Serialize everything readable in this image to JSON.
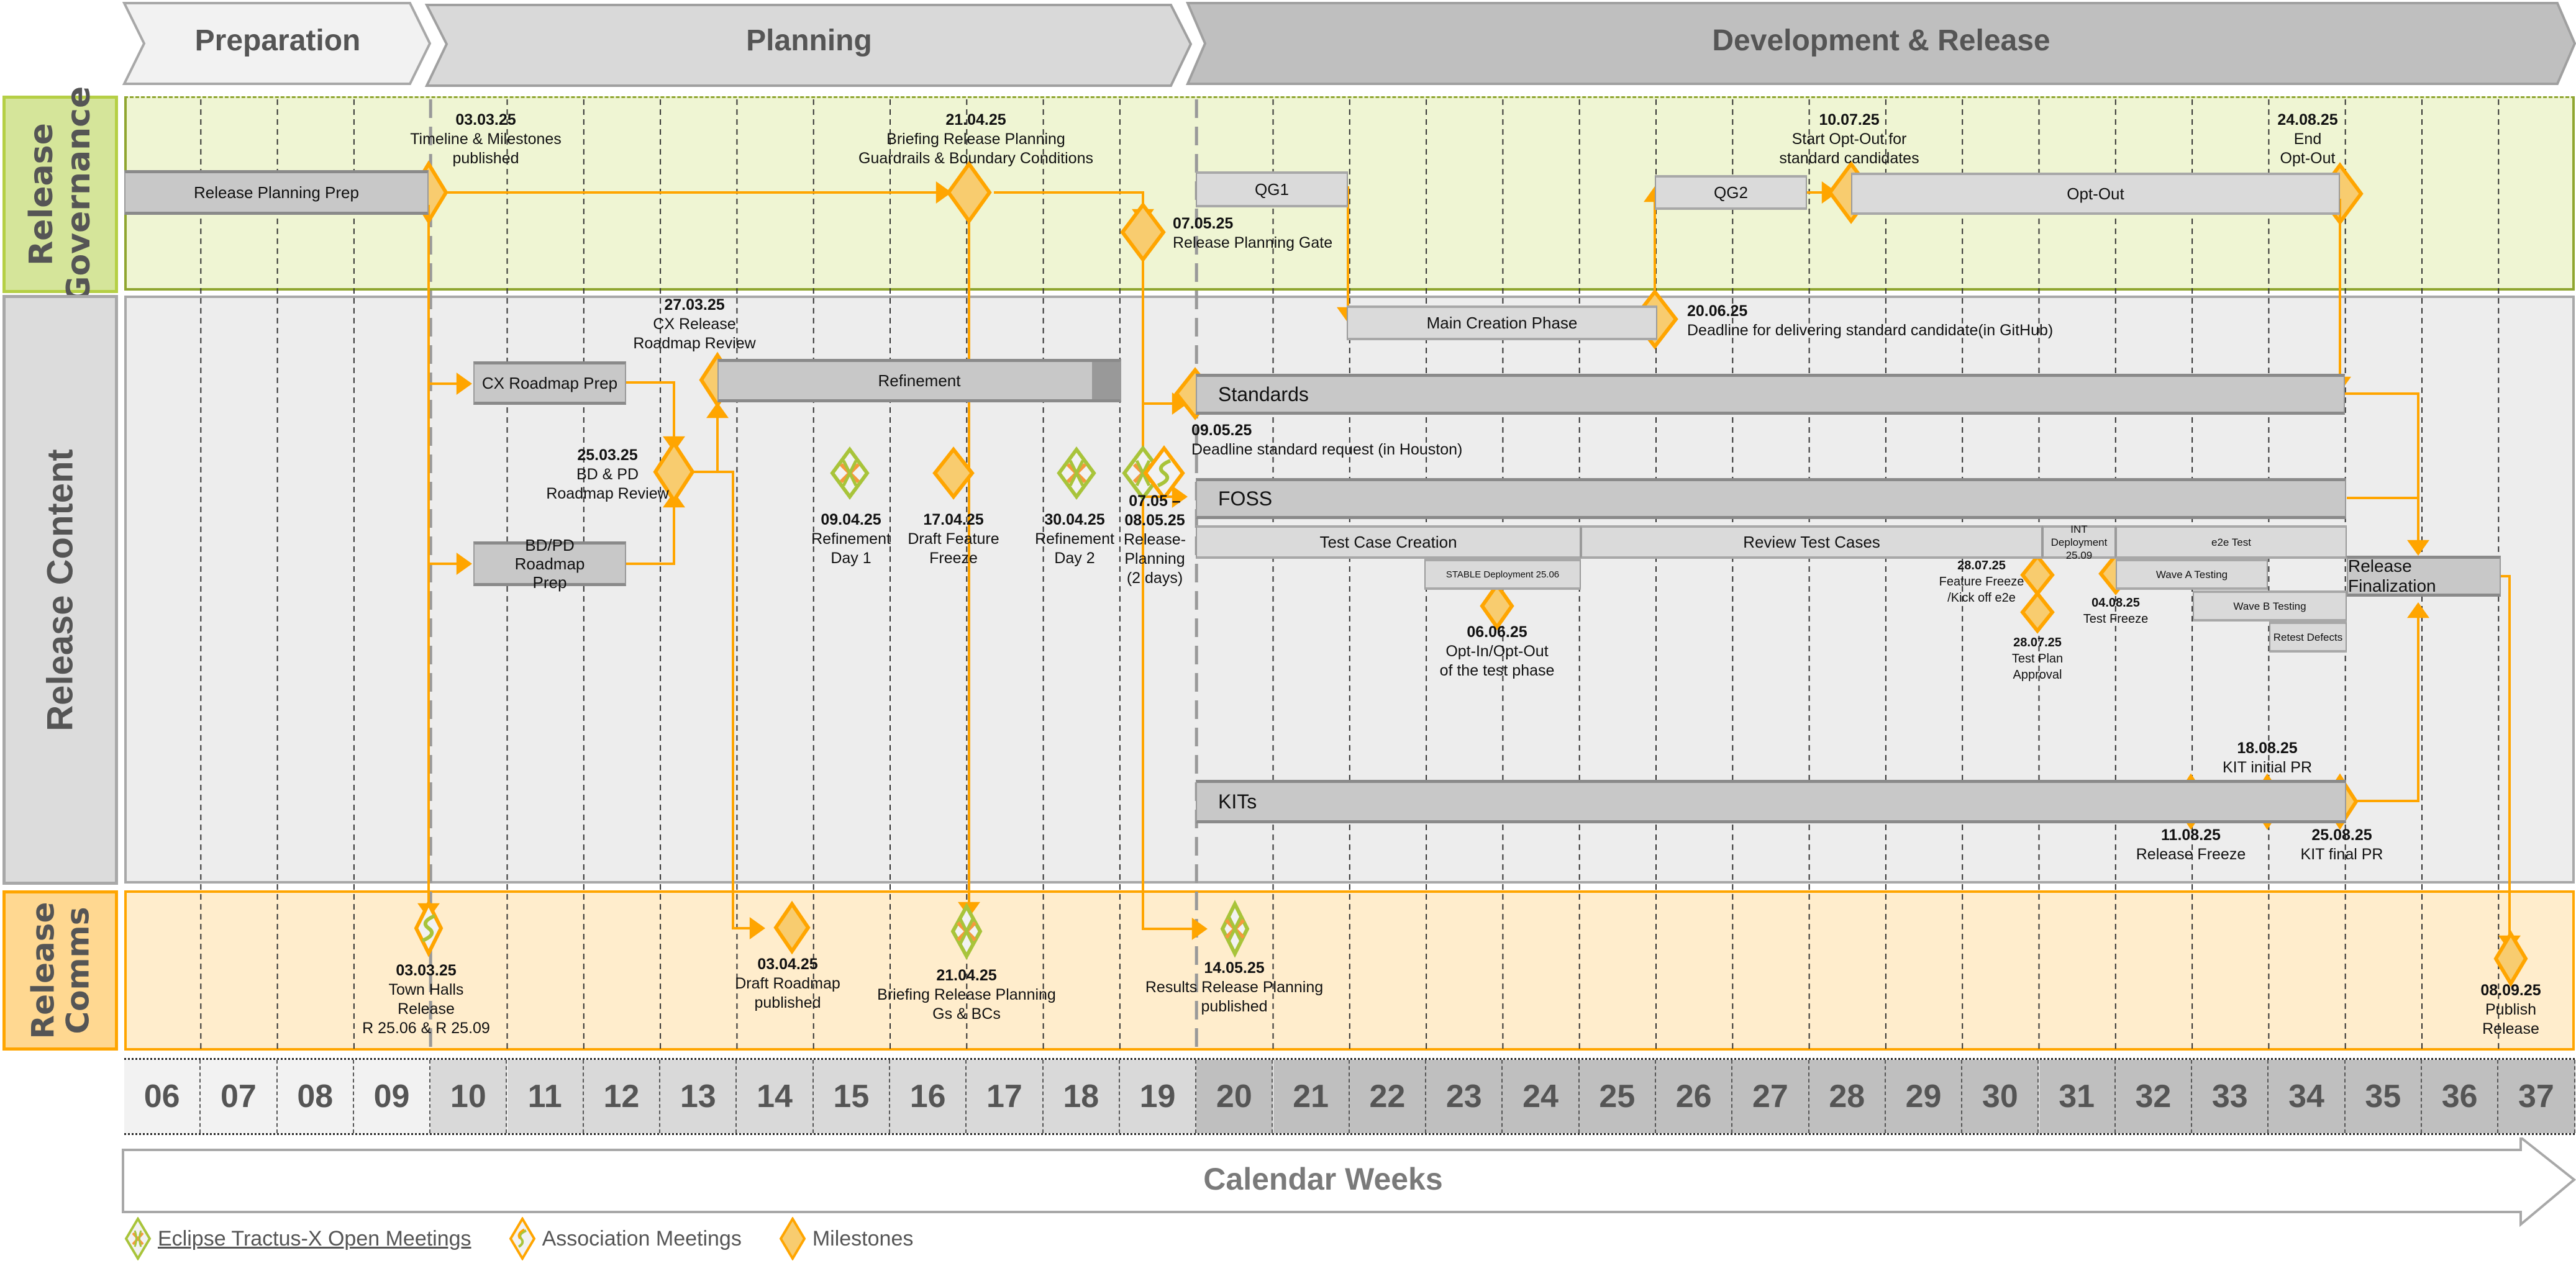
{
  "phases": [
    {
      "label": "Preparation",
      "from_week": 6,
      "to_week": 9
    },
    {
      "label": "Planning",
      "from_week": 10,
      "to_week": 19
    },
    {
      "label": "Development & Release",
      "from_week": 20,
      "to_week": 37
    }
  ],
  "lanes": [
    {
      "id": "governance",
      "label": "Release Governance",
      "lines": [
        "Release",
        "Governance"
      ]
    },
    {
      "id": "content",
      "label": "Release Content",
      "lines": [
        "Release Content"
      ]
    },
    {
      "id": "comms",
      "label": "Release Comms",
      "lines": [
        "Release",
        "Comms"
      ]
    }
  ],
  "weeks": [
    "06",
    "07",
    "08",
    "09",
    "10",
    "11",
    "12",
    "13",
    "14",
    "15",
    "16",
    "17",
    "18",
    "19",
    "20",
    "21",
    "22",
    "23",
    "24",
    "25",
    "26",
    "27",
    "28",
    "29",
    "30",
    "31",
    "32",
    "33",
    "34",
    "35",
    "36",
    "37"
  ],
  "axis_label": "Calendar Weeks",
  "legend": [
    {
      "icon": "eclipse-tractus-x-open-meeting-icon",
      "label": "Eclipse Tractus-X Open Meetings",
      "underlined": true
    },
    {
      "icon": "association-meeting-icon",
      "label": "Association Meetings"
    },
    {
      "icon": "milestone-icon",
      "label": "Milestones"
    }
  ],
  "colors": {
    "governance_bg": "#eff5d3",
    "governance_border": "#8fa530",
    "governance_title_bg": "#d5e59a",
    "content_bg": "#ededed",
    "content_title_bg": "#dcdcdc",
    "comms_bg": "#ffedcc",
    "comms_title_bg": "#ffd891",
    "accent_orange": "#ffa500",
    "milestone_fill": "#f8cc6f",
    "tractus_green": "#a8c43a"
  },
  "governance": {
    "bars": [
      {
        "label": "Release Planning Prep"
      },
      {
        "label": "QG1"
      },
      {
        "label": "QG2"
      },
      {
        "label": "Opt-Out"
      }
    ],
    "milestones": [
      {
        "date": "03.03.25",
        "text": [
          "Timeline & Milestones",
          "published"
        ]
      },
      {
        "date": "21.04.25",
        "text": [
          "Briefing Release Planning",
          "Guardrails & Boundary Conditions"
        ]
      },
      {
        "date": "07.05.25",
        "text": [
          "Release Planning Gate"
        ]
      },
      {
        "date": "10.07.25",
        "text": [
          "Start Opt-Out for",
          "standard candidates"
        ]
      },
      {
        "date": "24.08.25",
        "text": [
          "End",
          "Opt-Out"
        ]
      }
    ]
  },
  "content": {
    "bars": [
      {
        "label": "Main Creation Phase"
      },
      {
        "label": "CX Roadmap Prep"
      },
      {
        "label": "BD/PD  Roadmap Prep"
      },
      {
        "label": "Refinement"
      },
      {
        "label": "Standards"
      },
      {
        "label": "FOSS"
      },
      {
        "label": "Test Case Creation"
      },
      {
        "label": "Review Test Cases"
      },
      {
        "label": "INT Deployment 25.09"
      },
      {
        "label": "e2e Test"
      },
      {
        "label": "STABLE Deployment 25.06"
      },
      {
        "label": "Wave A Testing"
      },
      {
        "label": "Wave B Testing"
      },
      {
        "label": "Retest Defects"
      },
      {
        "label": "Release Finalization"
      },
      {
        "label": "KITs"
      }
    ],
    "milestones": [
      {
        "date": "20.06.25",
        "text": [
          "Deadline for delivering standard candidate(in GitHub)"
        ]
      },
      {
        "date": "27.03.25",
        "text": [
          "CX Release",
          "Roadmap Review"
        ]
      },
      {
        "date": "25.03.25",
        "text": [
          "BD & PD",
          "Roadmap Review"
        ]
      },
      {
        "date": "09.04.25",
        "text": [
          "Refinement",
          "Day 1"
        ],
        "type": "tractus"
      },
      {
        "date": "17.04.25",
        "text": [
          "Draft Feature",
          "Freeze"
        ]
      },
      {
        "date": "30.04.25",
        "text": [
          "Refinement",
          "Day 2"
        ],
        "type": "tractus"
      },
      {
        "date": "07.05 –",
        "date2": "08.05.25",
        "text": [
          "Release-",
          "Planning",
          "(2 days)"
        ],
        "type": "tractus+association"
      },
      {
        "date": "09.05.25",
        "text": [
          "Deadline standard request (in  Houston)"
        ]
      },
      {
        "date": "06.06.25",
        "text": [
          "Opt-In/Opt-Out",
          "of the test phase"
        ]
      },
      {
        "date": "28.07.25",
        "text": [
          "Feature Freeze",
          "/Kick off e2e"
        ]
      },
      {
        "date": "28.07.25",
        "text": [
          "Test Plan",
          "Approval"
        ]
      },
      {
        "date": "04.08.25",
        "text": [
          "Test Freeze"
        ]
      },
      {
        "date": "11.08.25",
        "text": [
          "Release Freeze"
        ]
      },
      {
        "date": "18.08.25",
        "text": [
          "KIT initial PR"
        ]
      },
      {
        "date": "25.08.25",
        "text": [
          "KIT final PR"
        ]
      }
    ]
  },
  "comms": {
    "milestones": [
      {
        "date": "03.03.25",
        "text": [
          "Town Halls",
          "Release",
          "R 25.06 & R 25.09"
        ],
        "type": "association"
      },
      {
        "date": "03.04.25",
        "text": [
          "Draft Roadmap",
          "published"
        ]
      },
      {
        "date": "21.04.25",
        "text": [
          "Briefing Release Planning",
          "Gs & BCs"
        ],
        "type": "tractus"
      },
      {
        "date": "14.05.25",
        "text": [
          "Results Release Planning",
          "published"
        ],
        "type": "tractus"
      },
      {
        "date": "08.09.25",
        "text": [
          "Publish",
          "Release"
        ]
      }
    ]
  }
}
